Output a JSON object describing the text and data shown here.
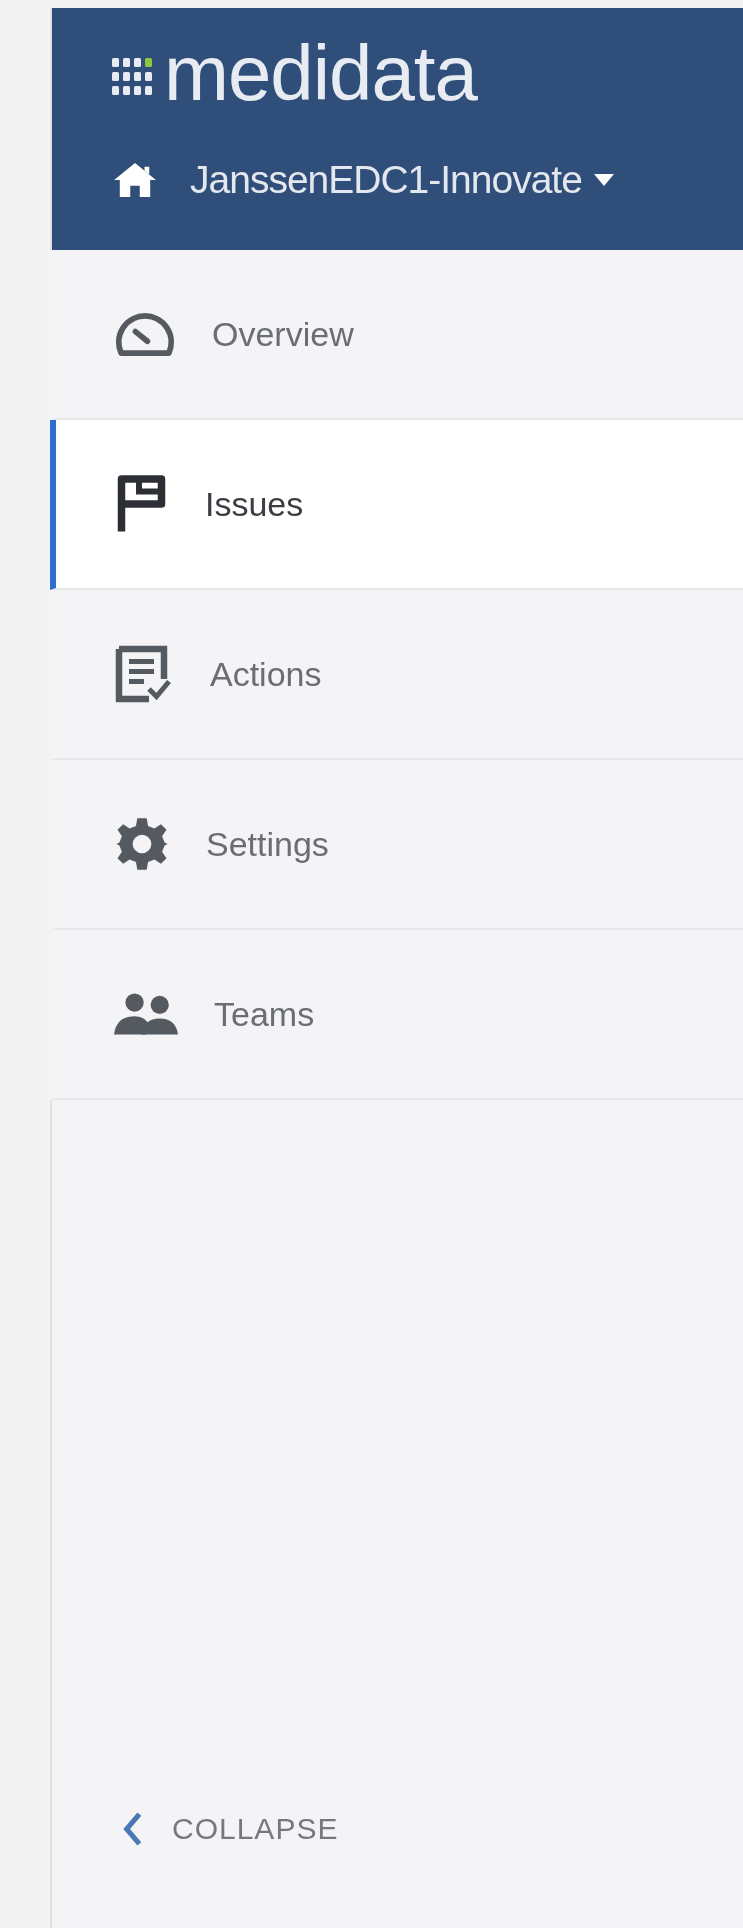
{
  "logo": {
    "text": "medidata"
  },
  "project": {
    "label": "JanssenEDC1-Innovate"
  },
  "nav": [
    {
      "kind": "overview",
      "label": "Overview",
      "selected": false
    },
    {
      "kind": "issues",
      "label": "Issues",
      "selected": true
    },
    {
      "kind": "actions",
      "label": "Actions",
      "selected": false
    },
    {
      "kind": "settings",
      "label": "Settings",
      "selected": false
    },
    {
      "kind": "teams",
      "label": "Teams",
      "selected": false
    }
  ],
  "collapse": {
    "label": "COLLAPSE"
  }
}
